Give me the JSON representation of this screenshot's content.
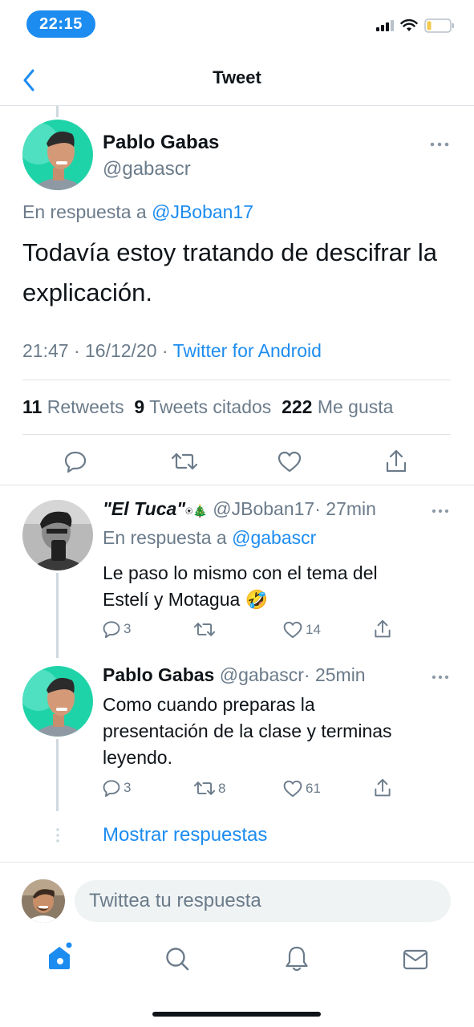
{
  "status_bar": {
    "time": "22:15"
  },
  "nav": {
    "title": "Tweet"
  },
  "main_tweet": {
    "author_name": "Pablo Gabas",
    "author_handle": "@gabascr",
    "reply_prefix": "En respuesta a",
    "reply_to": "@JBoban17",
    "text": "Todavía estoy tratando de descifrar la explicación.",
    "timestamp": "21:47 · 16/12/20 ·",
    "source": "Twitter for Android",
    "stats": {
      "retweets_count": "11",
      "retweets_label": "Retweets",
      "quotes_count": "9",
      "quotes_label": "Tweets citados",
      "likes_count": "222",
      "likes_label": "Me gusta"
    }
  },
  "replies": [
    {
      "author_name": "\"El Tuca\"",
      "author_emoji": "⍟🎄",
      "author_handle": "@JBoban17",
      "time": "· 27min",
      "reply_prefix": "En respuesta a",
      "reply_to": "@gabascr",
      "text_line1": "Le paso lo mismo con el tema del",
      "text_line2": "Estelí y Motagua 🤣",
      "replies": "3",
      "retweets": "",
      "likes": "14"
    },
    {
      "author_name": "Pablo Gabas",
      "author_handle": "@gabascr",
      "time": "· 25min",
      "text_line1": "Como cuando preparas la",
      "text_line2": "presentación de la clase y terminas",
      "text_line3": "leyendo.",
      "replies": "3",
      "retweets": "8",
      "likes": "61"
    }
  ],
  "show_replies": "Mostrar respuestas",
  "composer": {
    "placeholder": "Twittea tu respuesta"
  },
  "icons": {
    "back": "chevron-left-icon",
    "more": "more-icon",
    "reply": "reply-icon",
    "retweet": "retweet-icon",
    "like": "heart-icon",
    "share": "share-icon",
    "home": "home-icon",
    "search": "search-icon",
    "notifications": "bell-icon",
    "messages": "mail-icon"
  },
  "colors": {
    "accent": "#1d8cf0",
    "muted": "#6b7b8a",
    "divider": "#dfe3e8",
    "thread_line": "#cfd9de"
  }
}
